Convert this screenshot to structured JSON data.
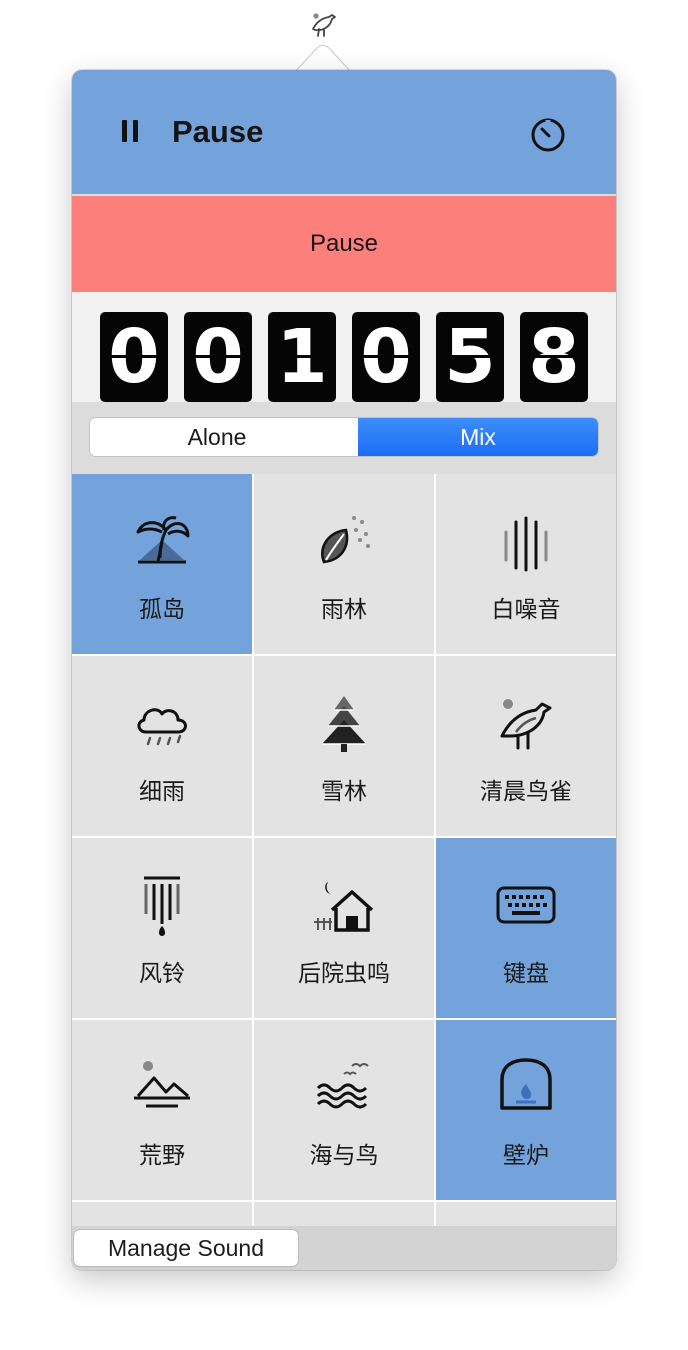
{
  "menubar": {
    "icon": "bird-icon"
  },
  "header": {
    "title": "Pause",
    "pause_icon": "pause-icon",
    "timer_icon": "timer-icon",
    "background": "#74a3dc"
  },
  "banner": {
    "label": "Pause",
    "background": "#fd7f7c"
  },
  "counter": {
    "digits": [
      "0",
      "0",
      "1",
      "0",
      "5",
      "8"
    ]
  },
  "mode": {
    "options": [
      "Alone",
      "Mix"
    ],
    "selected": "Mix",
    "accent": "#1b6ef4"
  },
  "sounds": [
    {
      "label": "孤岛",
      "icon": "island-icon",
      "active": true
    },
    {
      "label": "雨林",
      "icon": "rainforest-icon",
      "active": false
    },
    {
      "label": "白噪音",
      "icon": "white-noise-icon",
      "active": false
    },
    {
      "label": "细雨",
      "icon": "drizzle-icon",
      "active": false
    },
    {
      "label": "雪林",
      "icon": "snow-forest-icon",
      "active": false
    },
    {
      "label": "清晨鸟雀",
      "icon": "bird-icon",
      "active": false
    },
    {
      "label": "风铃",
      "icon": "wind-chime-icon",
      "active": false
    },
    {
      "label": "后院虫鸣",
      "icon": "backyard-icon",
      "active": false
    },
    {
      "label": "键盘",
      "icon": "keyboard-icon",
      "active": true
    },
    {
      "label": "荒野",
      "icon": "wilderness-icon",
      "active": false
    },
    {
      "label": "海与鸟",
      "icon": "sea-birds-icon",
      "active": false
    },
    {
      "label": "壁炉",
      "icon": "fireplace-icon",
      "active": true
    }
  ],
  "footer": {
    "manage_label": "Manage Sound"
  }
}
